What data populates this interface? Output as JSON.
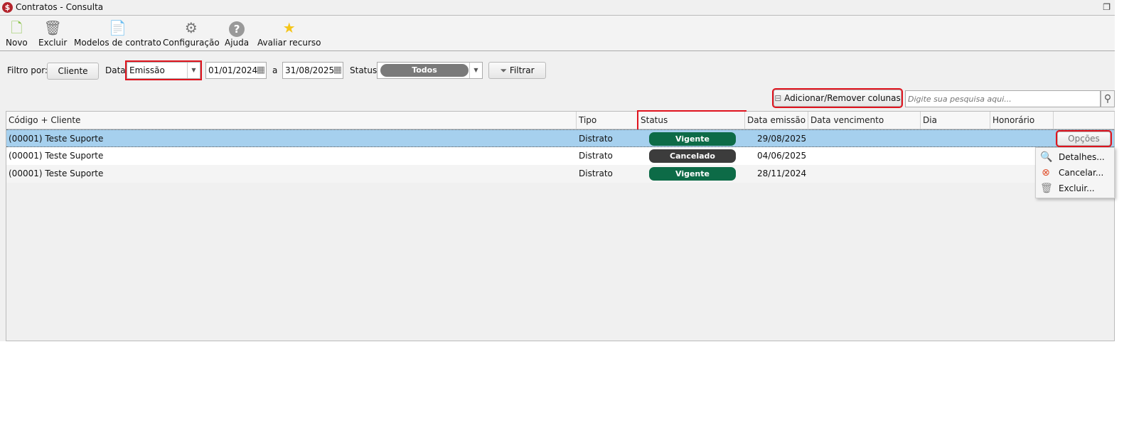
{
  "window": {
    "title": "Contratos - Consulta"
  },
  "toolbar": [
    {
      "label": "Novo",
      "icon": "new-document-icon"
    },
    {
      "label": "Excluir",
      "icon": "trash-icon"
    },
    {
      "label": "Modelos de contrato",
      "icon": "contract-template-icon"
    },
    {
      "label": "Configuração",
      "icon": "gear-icon"
    },
    {
      "label": "Ajuda",
      "icon": "help-icon"
    },
    {
      "label": "Avaliar recurso",
      "icon": "star-icon"
    }
  ],
  "filters": {
    "filter_by_label": "Filtro por:",
    "client_button": "Cliente",
    "date_label": "Data:",
    "date_type": "Emissão",
    "date_from": "01/01/2024",
    "to_label": "a",
    "date_to": "31/08/2025",
    "status_label": "Status:",
    "status_value": "Todos",
    "filter_button": "Filtrar"
  },
  "columns_button": "Adicionar/Remover colunas",
  "search": {
    "placeholder": "Digite sua pesquisa aqui..."
  },
  "table": {
    "headers": [
      "Código + Cliente",
      "Tipo",
      "Status",
      "Data emissão",
      "Data vencimento contrato",
      "Dia vencimento",
      "Honorário"
    ],
    "rows": [
      {
        "cliente": "(00001) Teste Suporte",
        "tipo": "Distrato",
        "status": "Vigente",
        "emissao": "29/08/2025",
        "status_color": "#0d6b47"
      },
      {
        "cliente": "(00001) Teste Suporte",
        "tipo": "Distrato",
        "status": "Cancelado",
        "emissao": "04/06/2025",
        "status_color": "#3c3c3c"
      },
      {
        "cliente": "(00001) Teste Suporte",
        "tipo": "Distrato",
        "status": "Vigente",
        "emissao": "28/11/2024",
        "status_color": "#0d6b47"
      }
    ],
    "options_button": "Opções"
  },
  "options_menu": [
    {
      "label": "Detalhes...",
      "icon": "details-icon"
    },
    {
      "label": "Cancelar...",
      "icon": "cancel-icon"
    },
    {
      "label": "Excluir...",
      "icon": "trash-icon"
    }
  ],
  "colors": {
    "selected_row": "#a6d0ee",
    "highlight": "#e0141e"
  }
}
